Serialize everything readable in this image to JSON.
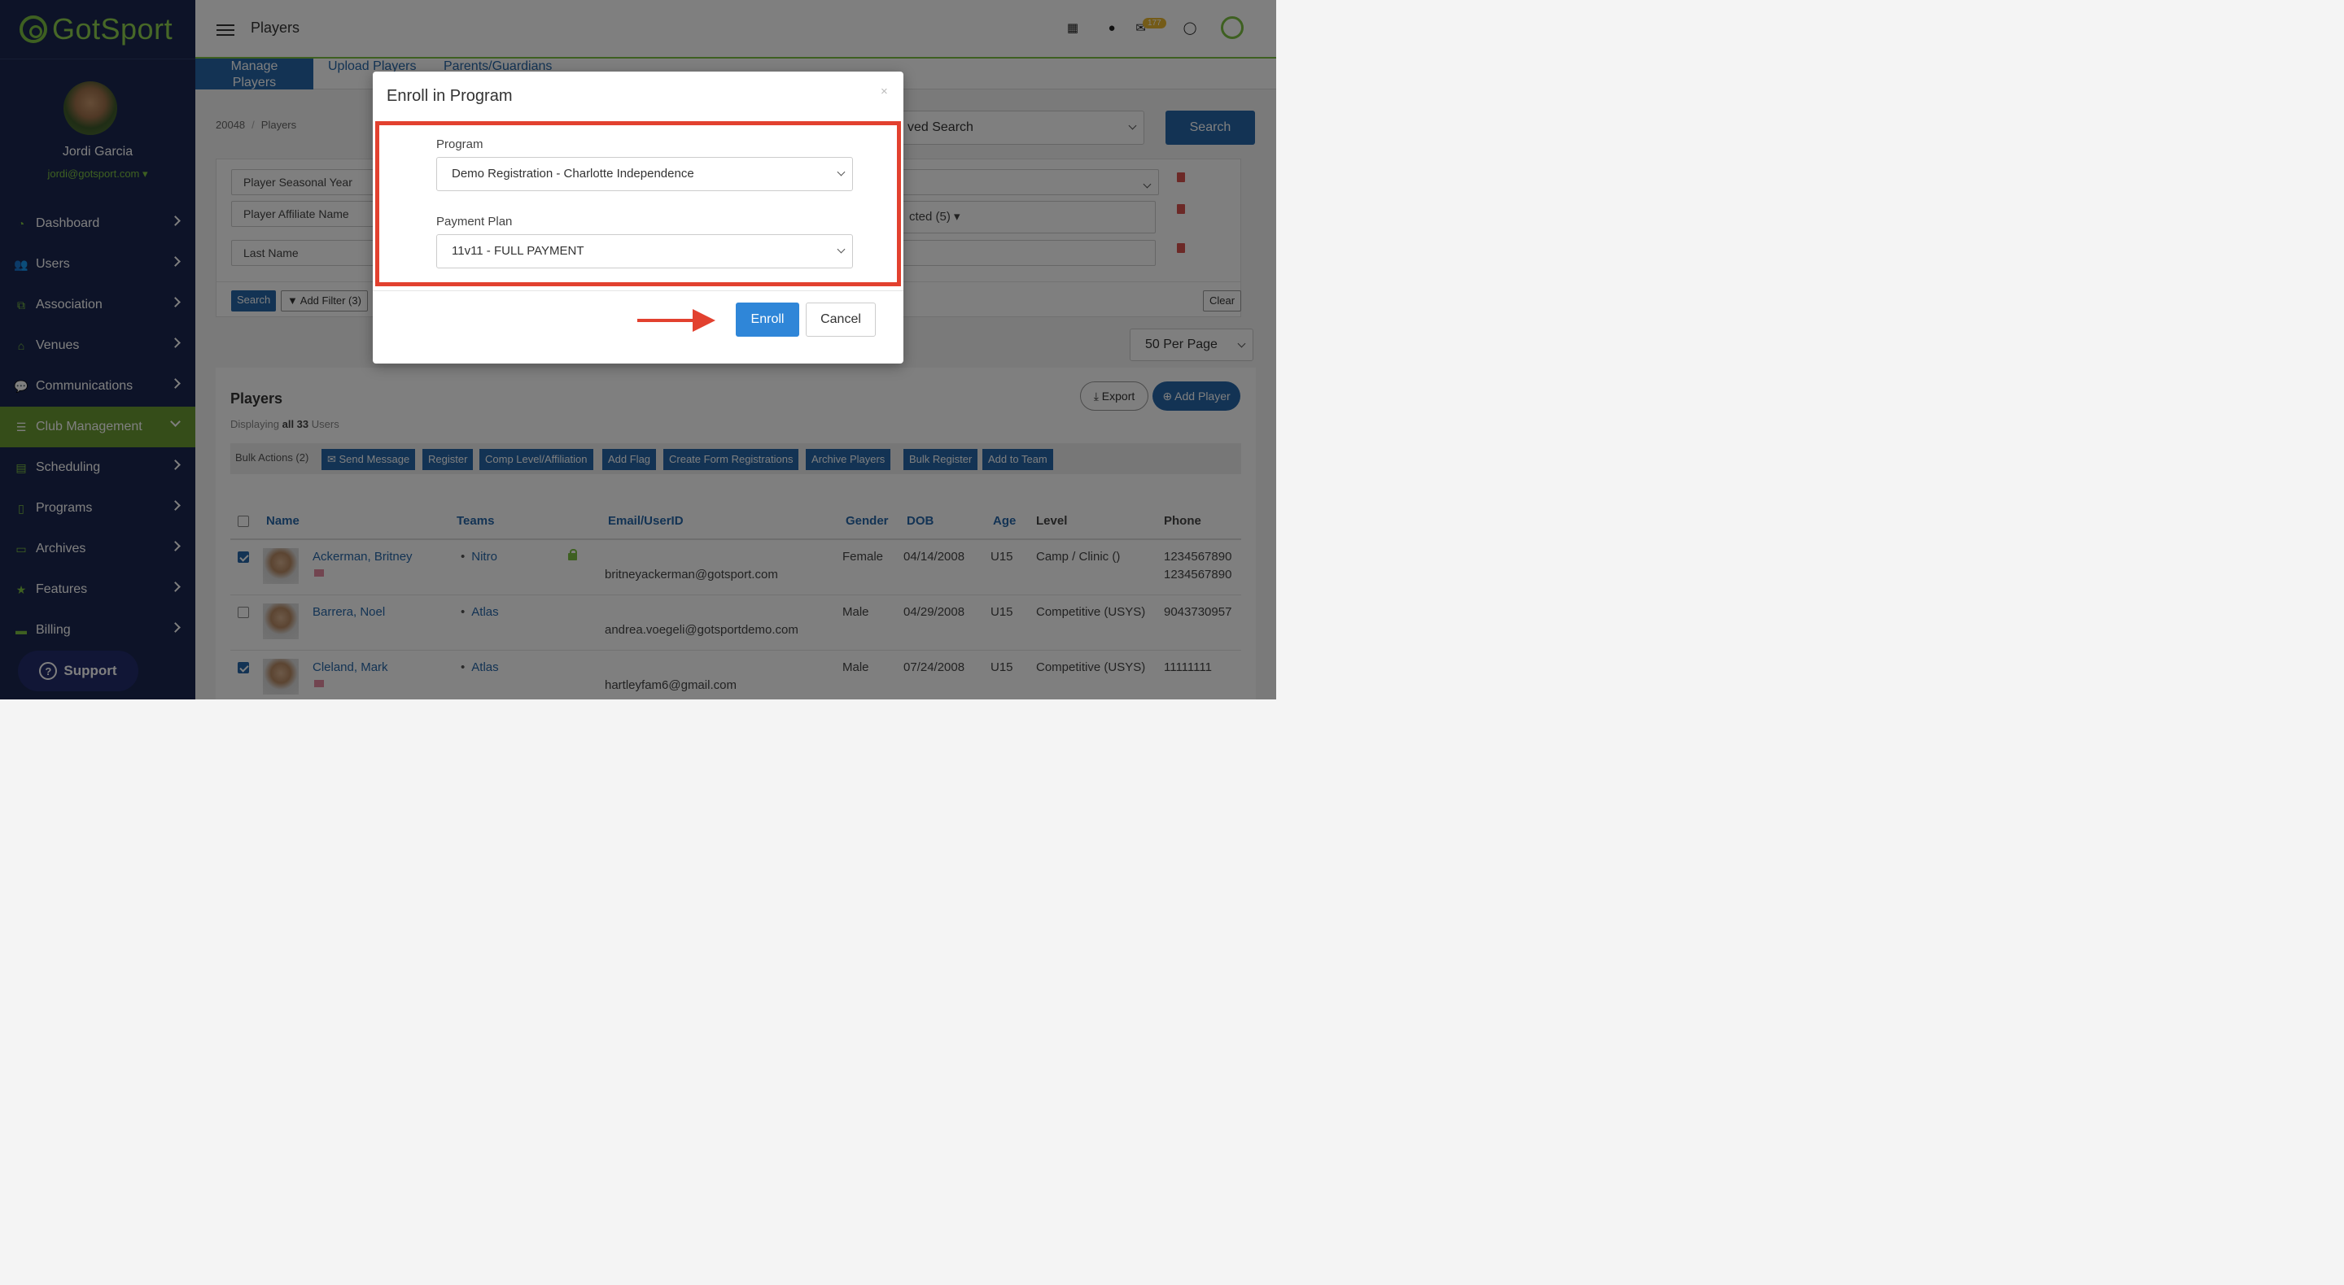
{
  "app": {
    "logo_text": "GotSport",
    "page_title": "Players"
  },
  "sidebar": {
    "user_name": "Jordi Garcia",
    "user_email": "jordi@gotsport.com",
    "items": [
      {
        "label": "Dashboard",
        "icon": "dashboard-icon",
        "glyph": "◔"
      },
      {
        "label": "Users",
        "icon": "users-icon",
        "glyph": "👥"
      },
      {
        "label": "Association",
        "icon": "sitemap-icon",
        "glyph": "⧉"
      },
      {
        "label": "Venues",
        "icon": "home-icon",
        "glyph": "⌂"
      },
      {
        "label": "Communications",
        "icon": "chat-icon",
        "glyph": "💬"
      },
      {
        "label": "Club Management",
        "icon": "list-icon",
        "glyph": "☰"
      },
      {
        "label": "Scheduling",
        "icon": "calendar-icon",
        "glyph": "▤"
      },
      {
        "label": "Programs",
        "icon": "document-icon",
        "glyph": "▯"
      },
      {
        "label": "Archives",
        "icon": "archive-icon",
        "glyph": "▭"
      },
      {
        "label": "Features",
        "icon": "star-icon",
        "glyph": "★"
      },
      {
        "label": "Billing",
        "icon": "credit-card-icon",
        "glyph": "▬"
      }
    ],
    "support_label": "Support"
  },
  "header": {
    "mail_badge": "177"
  },
  "tabs": [
    "Manage Players",
    "Upload Players",
    "Parents/Guardians"
  ],
  "breadcrumb": {
    "id": "20048",
    "page": "Players"
  },
  "search": {
    "saved_search": "ved Search",
    "button": "Search"
  },
  "filters": {
    "fields": [
      "Player Seasonal Year",
      "Player Affiliate Name",
      "Last Name"
    ],
    "selected_label": "cted (5)",
    "search_button": "Search",
    "add_filter": "Add Filter (3)",
    "clear_button": "Clear"
  },
  "per_page": "50 Per Page",
  "players": {
    "title": "Players",
    "displaying_prefix": "Displaying",
    "displaying_bold": "all 33",
    "displaying_suffix": "Users",
    "export": "Export",
    "add_player": "Add Player",
    "bulk_label": "Bulk Actions (2)",
    "bulk_actions": [
      "Send Message",
      "Register",
      "Comp Level/Affiliation",
      "Add Flag",
      "Create Form Registrations",
      "Archive Players",
      "Bulk Register",
      "Add to Team"
    ],
    "columns": [
      "Name",
      "Teams",
      "Email/UserID",
      "Gender",
      "DOB",
      "Age",
      "Level",
      "Phone"
    ],
    "rows": [
      {
        "name": "Ackerman, Britney",
        "team": "Nitro",
        "email": "britneyackerman@gotsport.com",
        "gender": "Female",
        "dob": "04/14/2008",
        "age": "U15",
        "level": "Camp / Clinic ()",
        "phone": "1234567890",
        "phone2": "1234567890",
        "checked": true,
        "flag": true,
        "lock": true
      },
      {
        "name": "Barrera, Noel",
        "team": "Atlas",
        "email": "andrea.voegeli@gotsportdemo.com",
        "gender": "Male",
        "dob": "04/29/2008",
        "age": "U15",
        "level": "Competitive (USYS)",
        "phone": "9043730957",
        "phone2": "",
        "checked": false,
        "flag": false,
        "lock": false
      },
      {
        "name": "Cleland, Mark",
        "team": "Atlas",
        "email": "hartleyfam6@gmail.com",
        "gender": "Male",
        "dob": "07/24/2008",
        "age": "U15",
        "level": "Competitive (USYS)",
        "phone": "11111111",
        "phone2": "",
        "checked": true,
        "flag": true,
        "lock": false
      }
    ]
  },
  "modal": {
    "title": "Enroll in Program",
    "close": "×",
    "program_label": "Program",
    "program_value": "Demo Registration - Charlotte Independence",
    "plan_label": "Payment Plan",
    "plan_value": "11v11 - FULL PAYMENT",
    "enroll": "Enroll",
    "cancel": "Cancel"
  },
  "colors": {
    "sidebar": "#1a2650",
    "accent": "#7cc142",
    "primary": "#2767a8",
    "highlight": "#e2412f"
  }
}
